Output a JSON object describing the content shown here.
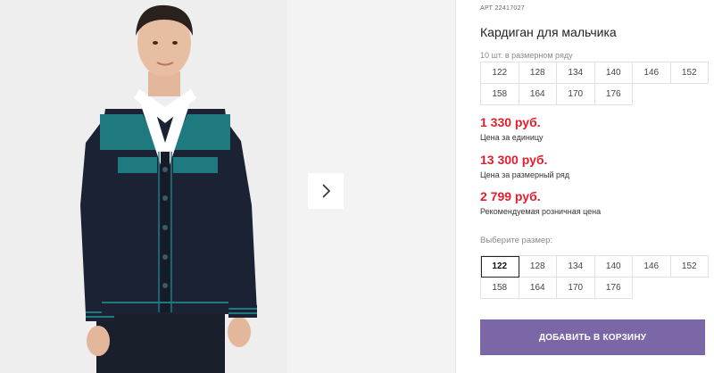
{
  "gallery": {
    "photo_alt_icon": "product-photo",
    "next_icon": "chevron-right-icon"
  },
  "product": {
    "art_prefix": "АРТ",
    "art_number": "22417027",
    "title": "Кардиган для мальчика",
    "range_note": "10 шт. в размерном ряду",
    "range_sizes": [
      "122",
      "128",
      "134",
      "140",
      "146",
      "152",
      "158",
      "164",
      "170",
      "176"
    ]
  },
  "prices": {
    "unit_price": "1 330 руб.",
    "unit_label": "Цена за единицу",
    "range_price": "13 300 руб.",
    "range_label": "Цена за размерный ряд",
    "retail_price": "2 799 руб.",
    "retail_label": "Рекомендуемая розничная цена"
  },
  "size_picker": {
    "label": "Выберите размер:",
    "sizes": [
      "122",
      "128",
      "134",
      "140",
      "146",
      "152",
      "158",
      "164",
      "170",
      "176"
    ],
    "selected": "122"
  },
  "cart": {
    "button_label": "ДОБАВИТЬ В КОРЗИНУ"
  },
  "colors": {
    "price_red": "#e31e2c",
    "button_purple": "#7b67a8",
    "sweater_navy": "#1b2233",
    "sweater_teal": "#1f7a80"
  }
}
